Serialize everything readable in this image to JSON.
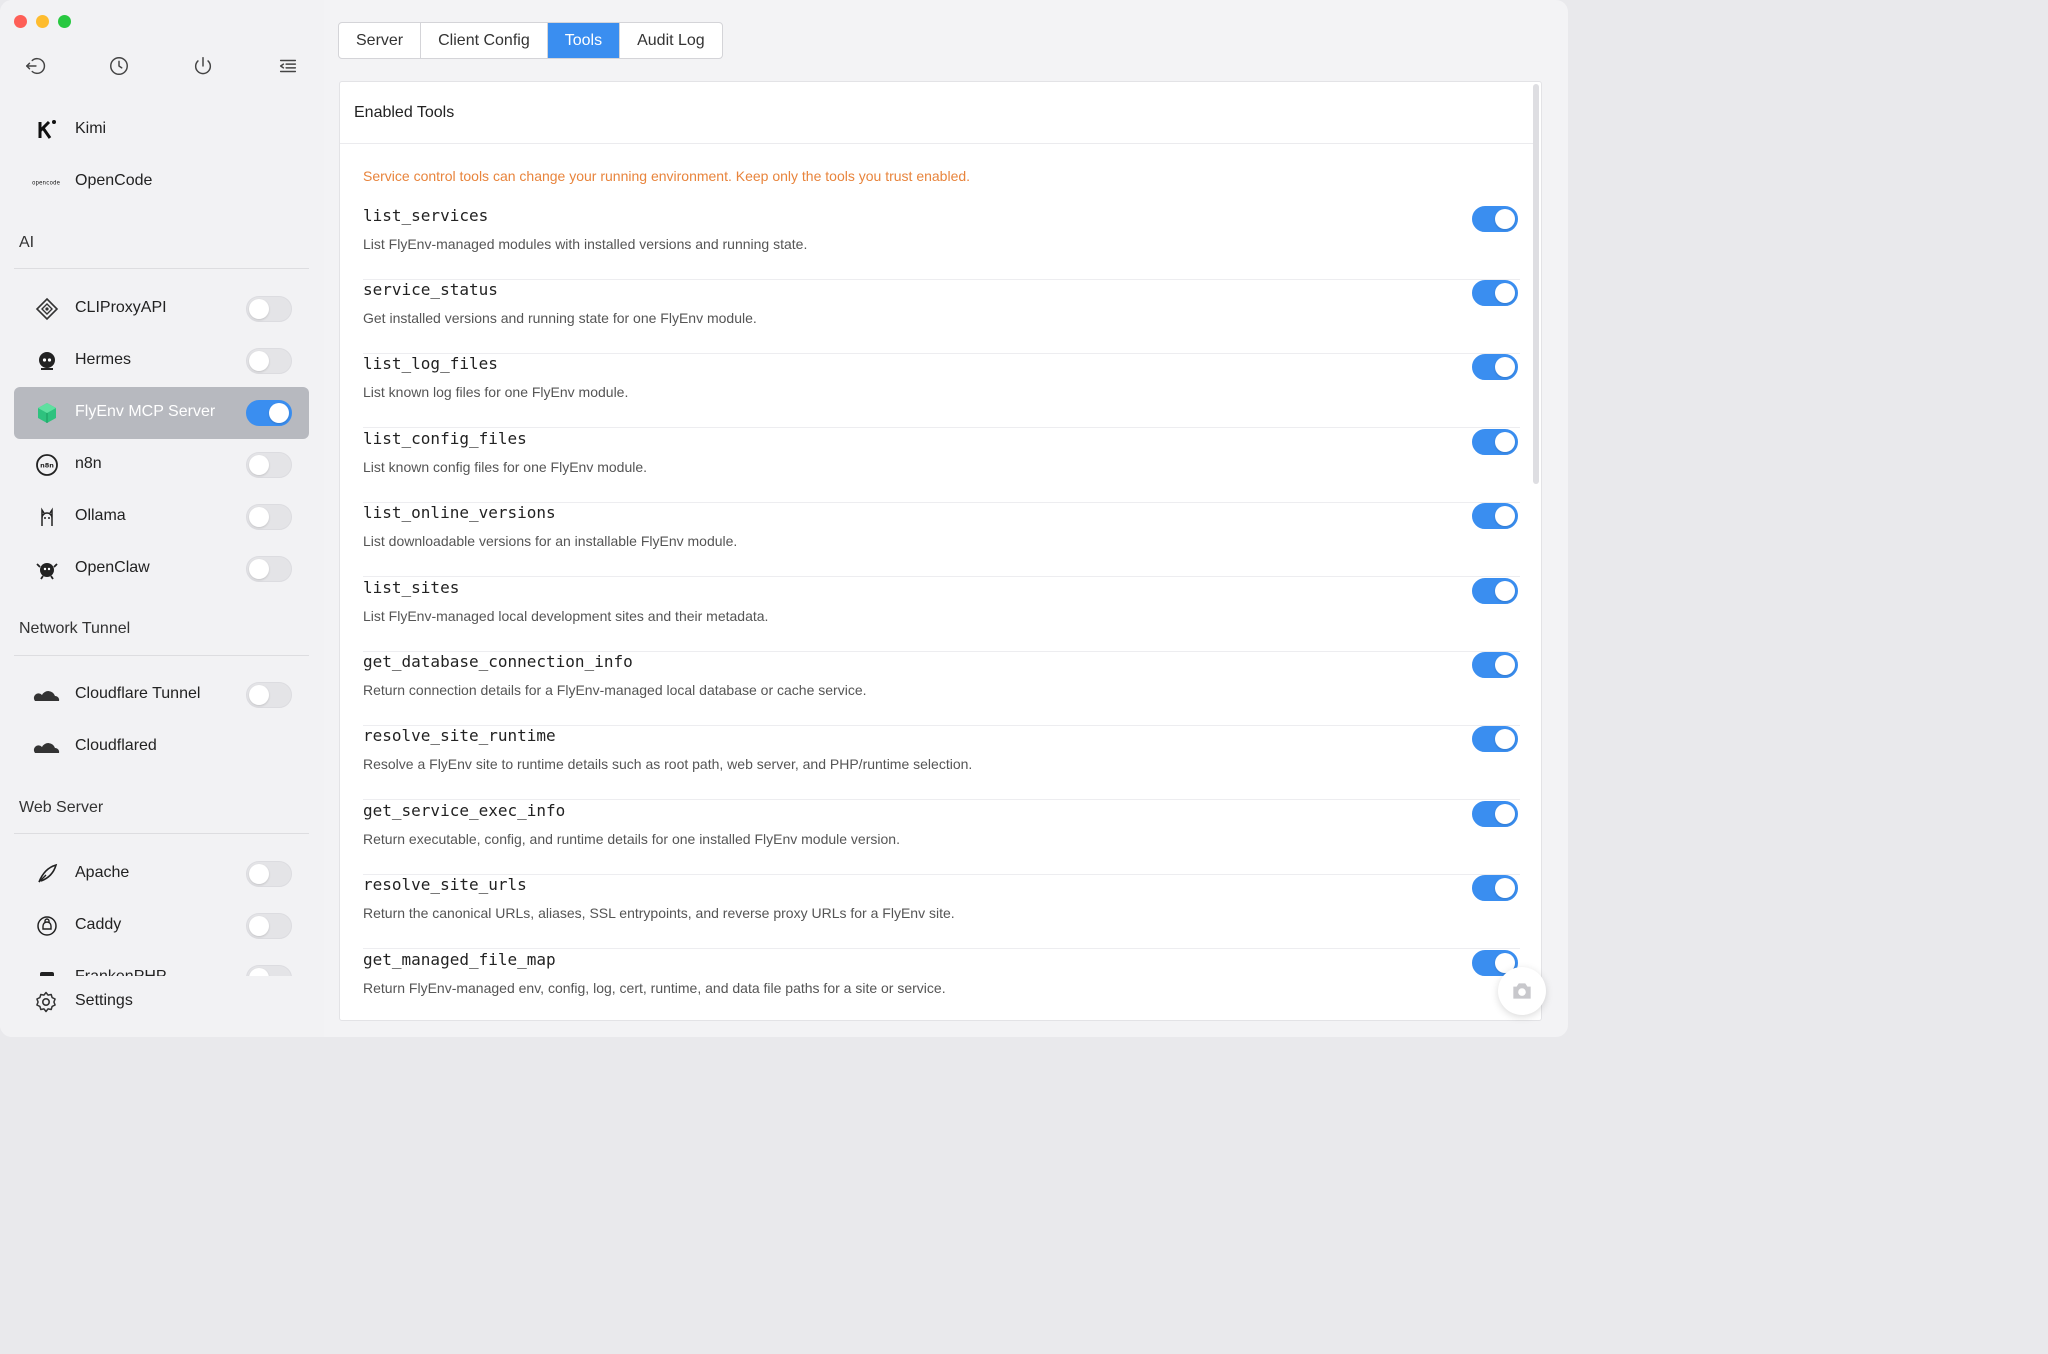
{
  "window": {
    "traffic_lights": [
      "close",
      "minimize",
      "zoom"
    ]
  },
  "sidebar": {
    "toolbar": [
      "back-icon",
      "clock-icon",
      "power-icon",
      "menu-collapse-icon"
    ],
    "items_top": [
      {
        "label": "Kimi",
        "icon": "kimi-icon"
      },
      {
        "label": "OpenCode",
        "icon": "opencode-icon"
      }
    ],
    "sections": [
      {
        "title": "AI",
        "items": [
          {
            "label": "CLIProxyAPI",
            "icon": "cliproxyapi-icon",
            "enabled": false
          },
          {
            "label": "Hermes",
            "icon": "hermes-icon",
            "enabled": false
          },
          {
            "label": "FlyEnv MCP Server",
            "icon": "mcp-cube-icon",
            "enabled": true,
            "active": true
          },
          {
            "label": "n8n",
            "icon": "n8n-icon",
            "enabled": false
          },
          {
            "label": "Ollama",
            "icon": "ollama-icon",
            "enabled": false
          },
          {
            "label": "OpenClaw",
            "icon": "openclaw-icon",
            "enabled": false
          }
        ]
      },
      {
        "title": "Network Tunnel",
        "items": [
          {
            "label": "Cloudflare Tunnel",
            "icon": "cloudflare-icon",
            "enabled": false
          },
          {
            "label": "Cloudflared",
            "icon": "cloudflare-icon"
          }
        ]
      },
      {
        "title": "Web Server",
        "items": [
          {
            "label": "Apache",
            "icon": "apache-feather-icon",
            "enabled": false
          },
          {
            "label": "Caddy",
            "icon": "caddy-icon",
            "enabled": false
          },
          {
            "label": "FrankenPHP",
            "icon": "frankenphp-icon",
            "enabled": false
          }
        ]
      }
    ],
    "settings_label": "Settings"
  },
  "tabs": [
    {
      "label": "Server",
      "active": false
    },
    {
      "label": "Client Config",
      "active": false
    },
    {
      "label": "Tools",
      "active": true
    },
    {
      "label": "Audit Log",
      "active": false
    }
  ],
  "panel": {
    "title": "Enabled Tools",
    "warning": "Service control tools can change your running environment. Keep only the tools you trust enabled.",
    "tools": [
      {
        "name": "list_services",
        "description": "List FlyEnv-managed modules with installed versions and running state.",
        "enabled": true
      },
      {
        "name": "service_status",
        "description": "Get installed versions and running state for one FlyEnv module.",
        "enabled": true
      },
      {
        "name": "list_log_files",
        "description": "List known log files for one FlyEnv module.",
        "enabled": true
      },
      {
        "name": "list_config_files",
        "description": "List known config files for one FlyEnv module.",
        "enabled": true
      },
      {
        "name": "list_online_versions",
        "description": "List downloadable versions for an installable FlyEnv module.",
        "enabled": true
      },
      {
        "name": "list_sites",
        "description": "List FlyEnv-managed local development sites and their metadata.",
        "enabled": true
      },
      {
        "name": "get_database_connection_info",
        "description": "Return connection details for a FlyEnv-managed local database or cache service.",
        "enabled": true
      },
      {
        "name": "resolve_site_runtime",
        "description": "Resolve a FlyEnv site to runtime details such as root path, web server, and PHP/runtime selection.",
        "enabled": true
      },
      {
        "name": "get_service_exec_info",
        "description": "Return executable, config, and runtime details for one installed FlyEnv module version.",
        "enabled": true
      },
      {
        "name": "resolve_site_urls",
        "description": "Return the canonical URLs, aliases, SSL entrypoints, and reverse proxy URLs for a FlyEnv site.",
        "enabled": true
      },
      {
        "name": "get_managed_file_map",
        "description": "Return FlyEnv-managed env, config, log, cert, runtime, and data file paths for a site or service.",
        "enabled": true
      }
    ]
  },
  "colors": {
    "accent": "#3a8ef0",
    "warning": "#e8843c",
    "active_row": "#b7b9bf"
  }
}
